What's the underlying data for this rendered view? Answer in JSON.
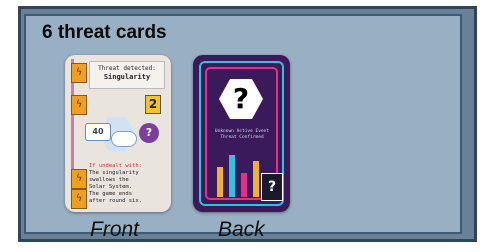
{
  "heading": "6 threat cards",
  "front": {
    "caption": "Front",
    "header_line1": "Threat detected:",
    "header_line2": "Singularity",
    "number": "2",
    "badge": "40",
    "ring_symbol": "?",
    "body_line1": "If undealt with:",
    "body_lines": [
      "The singularity",
      "swallows the",
      "Solar System.",
      "The game ends",
      "after round six."
    ]
  },
  "back": {
    "caption": "Back",
    "big_symbol": "?",
    "small_symbol": "?",
    "tag_line1": "Unknown Active Event",
    "tag_line2": "Threat Confirmed"
  },
  "colors": {
    "panel_outer": "#6a8096",
    "panel_inner": "#99b0c4",
    "card_back": "#3a1a5a",
    "accent_cyan": "#2fc3e0",
    "accent_magenta": "#e0308a",
    "accent_orange": "#f0a020"
  }
}
